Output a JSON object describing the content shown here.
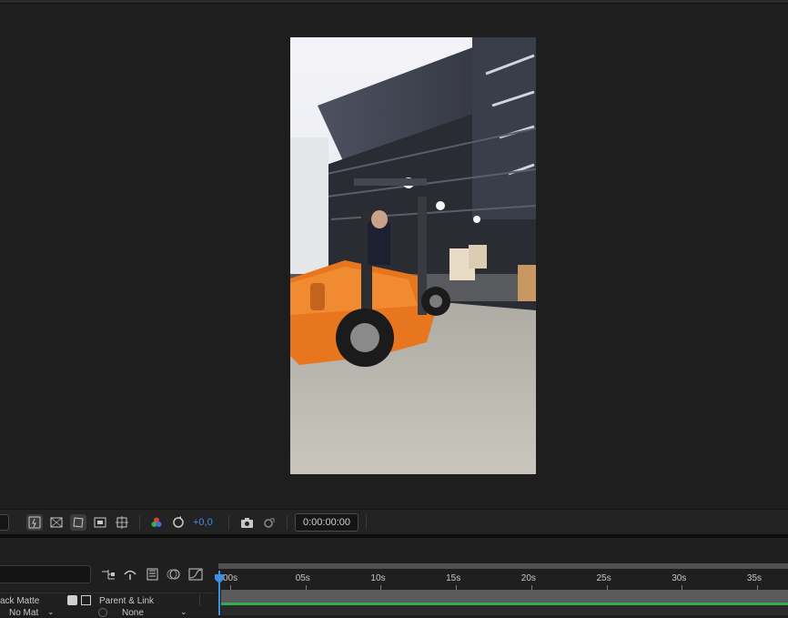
{
  "viewer_toolbar": {
    "exposure_value": "+0,0",
    "timecode": "0:00:00:00"
  },
  "timeline": {
    "columns": {
      "track_matte": "ack Matte",
      "parent_link": "Parent & Link"
    },
    "layer": {
      "matte_value": "No Mat",
      "parent_value": "None"
    },
    "ruler_labels": [
      "00s",
      "05s",
      "10s",
      "15s",
      "20s",
      "25s",
      "30s",
      "35s"
    ]
  },
  "colors": {
    "accent_blue": "#3d8fe0",
    "track_green": "#2fae4f",
    "forklift_orange": "#e8761f"
  }
}
